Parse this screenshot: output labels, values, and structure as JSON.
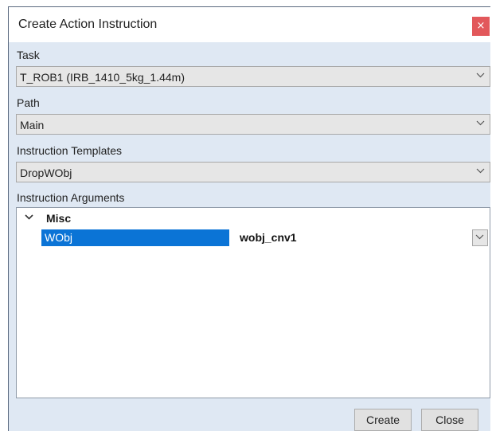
{
  "window": {
    "title": "Create Action Instruction",
    "close_glyph": "×"
  },
  "fields": {
    "task": {
      "label": "Task",
      "value": "T_ROB1 (IRB_1410_5kg_1.44m)"
    },
    "path": {
      "label": "Path",
      "value": "Main"
    },
    "template": {
      "label": "Instruction Templates",
      "value": "DropWObj"
    }
  },
  "arguments": {
    "label": "Instruction Arguments",
    "group": "Misc",
    "rows": [
      {
        "name": "WObj",
        "value": "wobj_cnv1"
      }
    ]
  },
  "buttons": {
    "create": "Create",
    "close": "Close"
  },
  "icons": {
    "dropdown": "chevron-down-icon",
    "group_toggle": "chevron-down-icon",
    "close": "close-icon"
  },
  "colors": {
    "dialog_bg": "#dfe8f3",
    "selection": "#0b74d6",
    "close_button": "#e2585b"
  }
}
